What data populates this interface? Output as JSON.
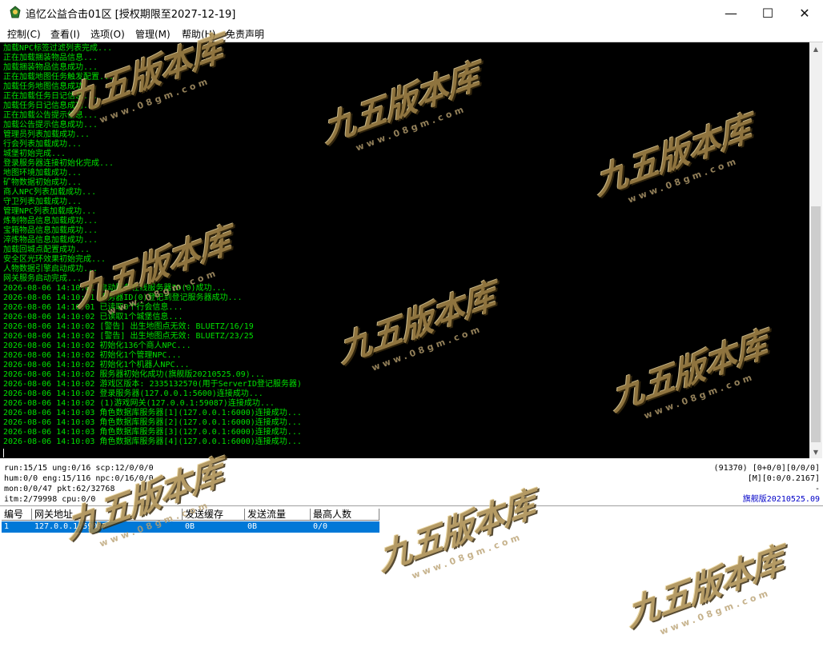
{
  "window": {
    "title": "追忆公益合击01区 [授权期限至2027-12-19]",
    "controls": [
      "—",
      "☐",
      "✕"
    ]
  },
  "menu": [
    "控制(C)",
    "查看(I)",
    "选项(O)",
    "管理(M)",
    "帮助(H)",
    "免责声明"
  ],
  "console": {
    "lines": [
      "加载NPC标签过滤列表完成...",
      "正在加载捆装物品信息...",
      "加载捆装物品信息成功...",
      "正在加载地图任务触发配置...",
      "加载任务地图信息成功...",
      "正在加载任务日记信息...",
      "加载任务日记信息成功...",
      "正在加载公告提示信息...",
      "加载公告提示信息成功...",
      "管理员列表加载成功...",
      "行会列表加载成功...",
      "城堡初始完成...",
      "登录服务器连接初始化完成...",
      "地图环境加载成功...",
      "矿物数据初始成功...",
      "商人NPC列表加载成功...",
      "守卫列表加载成功...",
      "管理NPC列表加载成功...",
      "炼制物品信息加载成功...",
      "宝箱物品信息加载成功...",
      "淬炼物品信息加载成功...",
      "加载回城点配置成功...",
      "安全区光环效果初始完成...",
      "人物数据引擎启动成功...",
      "网关服务启动完成...",
      "2026-08-06 14:10:01 启动服务在线服务器ID(0)成功...",
      "2026-08-06 14:10:01 服务器ID(0)登记到登记服务器成功...",
      "2026-08-06 14:10:01 已读取0个行会信息...",
      "2026-08-06 14:10:02 已读取1个城堡信息...",
      "2026-08-06 14:10:02 [警告] 出生地图点无效: BLUETZ/16/19",
      "2026-08-06 14:10:02 [警告] 出生地图点无效: BLUETZ/23/25",
      "2026-08-06 14:10:02 初始化136个商人NPC...",
      "2026-08-06 14:10:02 初始化1个管理NPC...",
      "2026-08-06 14:10:02 初始化1个机器人NPC...",
      "2026-08-06 14:10:02 服务器初始化成功(旗舰版20210525.09)...",
      "2026-08-06 14:10:02 游戏区版本: 2335132570(用于ServerID登记服务器)",
      "2026-08-06 14:10:02 登录服务器(127.0.0.1:5600)连接成功...",
      "2026-08-06 14:10:02 (1)游戏网关(127.0.0.1:59087)连接成功...",
      "2026-08-06 14:10:03 角色数据库服务器[1](127.0.0.1:6000)连接成功...",
      "2026-08-06 14:10:03 角色数据库服务器[2](127.0.0.1:6000)连接成功...",
      "2026-08-06 14:10:03 角色数据库服务器[3](127.0.0.1:6000)连接成功...",
      "2026-08-06 14:10:03 角色数据库服务器[4](127.0.0.1:6000)连接成功..."
    ]
  },
  "status": {
    "left": [
      "run:15/15 ung:0/16 scp:12/0/0/0",
      "hum:0/0 eng:15/116 npc:0/16/0/0",
      "mon:0/0/47 pkt:62/32768",
      "itm:2/79998 cpu:0/0"
    ],
    "right": [
      "(91370) [0+0/0][0/0/0]",
      "[M][0:0/0.2167]",
      "-",
      "旗舰版20210525.09"
    ]
  },
  "gateway_table": {
    "headers": [
      "编号",
      "网关地址",
      "发送缓存",
      "发送流量",
      "最高人数"
    ],
    "rows": [
      [
        "1",
        "127.0.0.1:59087",
        "0B",
        "0B",
        "0/0"
      ]
    ]
  },
  "watermark": {
    "text": "九五版本库",
    "url": "www.08gm.com"
  },
  "colors": {
    "console_bg": "#000000",
    "console_text": "#00e000",
    "selection": "#0078d7",
    "version_text": "#0000c8"
  }
}
